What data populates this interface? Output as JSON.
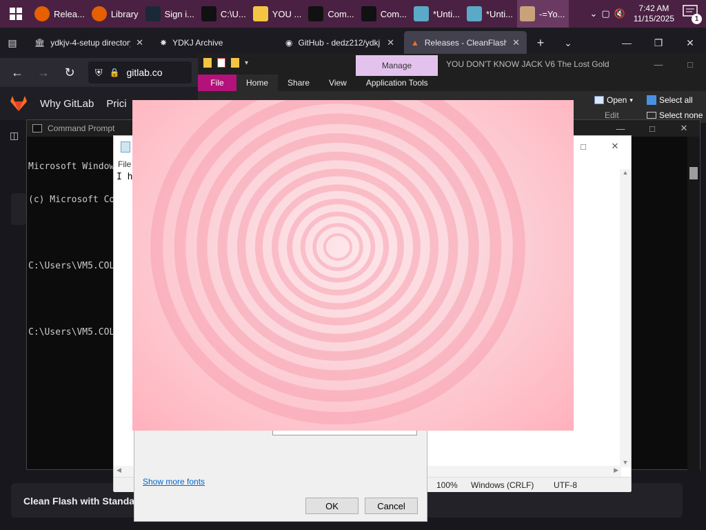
{
  "taskbar": {
    "items": [
      {
        "label": "Relea...",
        "icon": "firefox-icon",
        "color": "#e66000"
      },
      {
        "label": "Library",
        "icon": "firefox-icon",
        "color": "#e66000"
      },
      {
        "label": "Sign i...",
        "icon": "steam-icon",
        "color": "#1b2838"
      },
      {
        "label": "C:\\U...",
        "icon": "7zip-icon",
        "color": "#111111"
      },
      {
        "label": "YOU ...",
        "icon": "folder-icon",
        "color": "#f4c542"
      },
      {
        "label": "Com...",
        "icon": "cmd-icon",
        "color": "#111111"
      },
      {
        "label": "Com...",
        "icon": "cmd-icon",
        "color": "#111111"
      },
      {
        "label": "*Unti...",
        "icon": "notepad-icon",
        "color": "#5aa9c8"
      },
      {
        "label": "*Unti...",
        "icon": "notepad-icon",
        "color": "#5aa9c8"
      },
      {
        "label": "-=Yo...",
        "icon": "game-icon",
        "color": "#c9a27a"
      }
    ],
    "clock_time": "7:42 AM",
    "clock_date": "11/15/2025",
    "notification_count": "1"
  },
  "browser": {
    "tabs": [
      {
        "label": "ydkjv-4-setup directory"
      },
      {
        "label": "YDKJ Archive"
      },
      {
        "label": "GitHub - dedz212/ydkj"
      },
      {
        "label": "Releases - CleanFlash /"
      }
    ],
    "url": "gitlab.co",
    "gitlab_nav": [
      "Why GitLab",
      "Prici"
    ],
    "card_title": "Clean Flash with Standa"
  },
  "explorer": {
    "title": "YOU DON'T KNOW JACK V6 The Lost Gold",
    "manage": "Manage",
    "tabs": [
      "File",
      "Home",
      "Share",
      "View",
      "Application Tools"
    ],
    "open_label": "Open",
    "edit_label": "Edit",
    "select_all": "Select all",
    "select_none": "Select none"
  },
  "cmd": {
    "title": "Command Prompt",
    "lines": [
      "Microsoft Window",
      "(c) Microsoft Co",
      "",
      "C:\\Users\\VM5.COL",
      "",
      "C:\\Users\\VM5.COL"
    ]
  },
  "notepad": {
    "menu_file": "File",
    "text": "I h",
    "zoom": "100%",
    "line_ending": "Windows (CRLF)",
    "encoding": "UTF-8"
  },
  "font_dialog": {
    "show_more_fonts": "Show more fonts",
    "ok": "OK",
    "cancel": "Cancel"
  },
  "overlay": {
    "accent": "#f7a3b1"
  }
}
